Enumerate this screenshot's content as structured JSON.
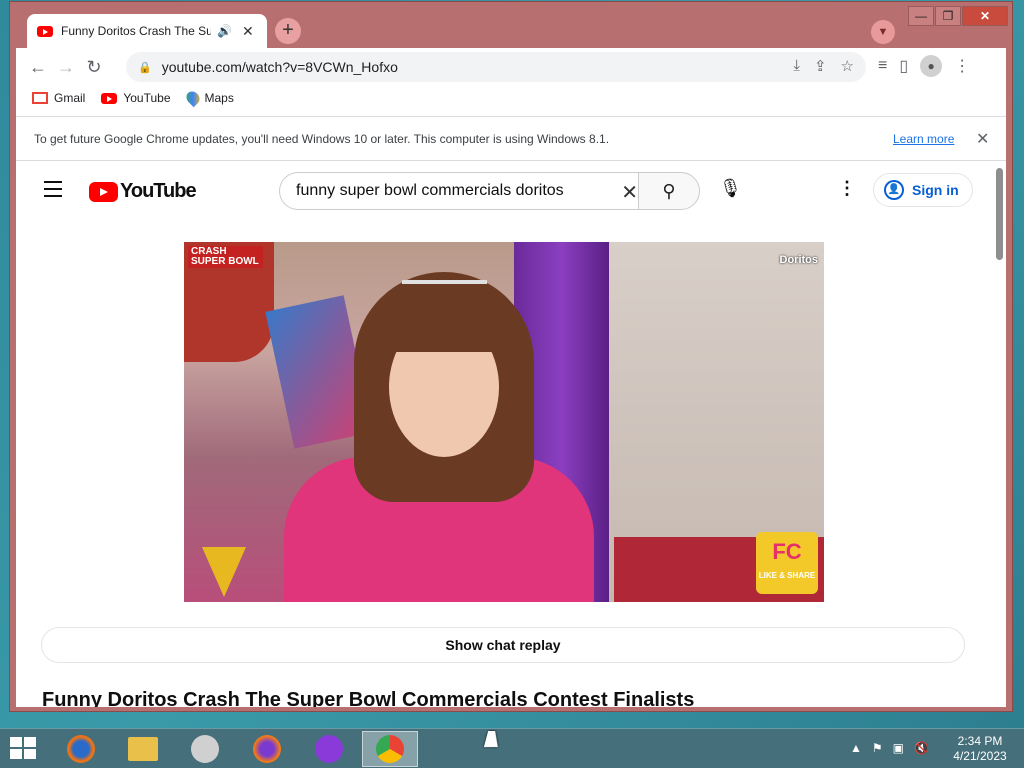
{
  "browser": {
    "tab_title": "Funny Doritos Crash The Sup",
    "url": "youtube.com/watch?v=8VCWn_Hofxo",
    "bookmarks": [
      "Gmail",
      "YouTube",
      "Maps"
    ],
    "infobar_text": "To get future Google Chrome updates, you'll need Windows 10 or later. This computer is using Windows 8.1.",
    "infobar_link": "Learn more"
  },
  "youtube": {
    "logo_text": "YouTube",
    "search_query": "funny super bowl commercials doritos",
    "signin_label": "Sign in",
    "player_badge_left": "CRASH SUPER BOWL",
    "player_badge_right": "Doritos",
    "player_badge_fc": "FC",
    "player_badge_fc_sub": "LIKE & SHARE",
    "chat_replay": "Show chat replay",
    "video_title": "Funny Doritos Crash The Super Bowl Commercials Contest Finalists"
  },
  "taskbar": {
    "time": "2:34 PM",
    "date": "4/21/2023"
  },
  "colors": {
    "window_frame": "#b86f6f",
    "yt_red": "#ff0000",
    "link_blue": "#065fd4",
    "close_red": "#c84b3e"
  }
}
